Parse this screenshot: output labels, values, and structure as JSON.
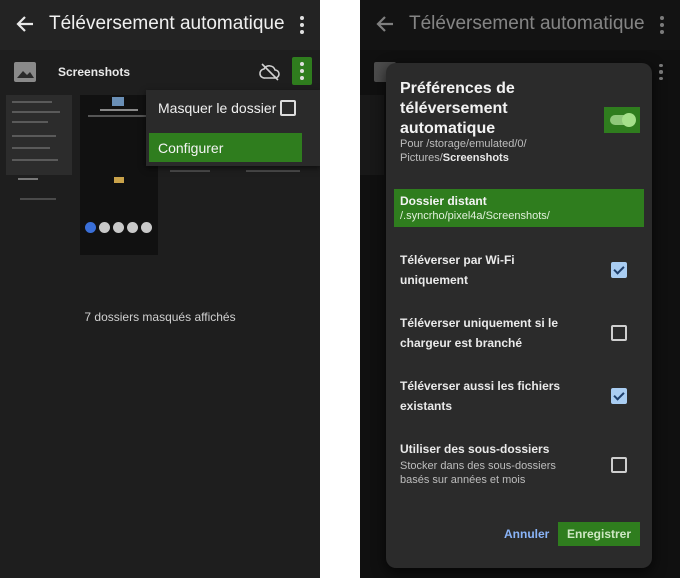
{
  "left_screen": {
    "appbar": {
      "title": "Téléversement automatique",
      "back_icon": "arrow-left-icon",
      "menu_icon": "kebab-icon"
    },
    "folder": {
      "name": "Screenshots",
      "icon": "image-icon",
      "cloud_icon": "cloud-off-icon",
      "menu_icon": "kebab-icon"
    },
    "popup_menu": {
      "hide_folder_label": "Masquer le dossier",
      "hide_folder_checked": false,
      "configure_label": "Configurer"
    },
    "hidden_folders_text": "7 dossiers masqués affichés"
  },
  "right_screen": {
    "appbar": {
      "title": "Téléversement automatique"
    },
    "dialog": {
      "title": "Préférences de téléversement automatique",
      "path_prefix": "Pour /storage/emulated/0/ Pictures/",
      "path_folder": "Screenshots",
      "enabled": true,
      "remote_folder_label": "Dossier distant",
      "remote_folder_value": "/.syncrho/pixel4a/Screenshots/",
      "options": [
        {
          "label": "Téléverser par Wi-Fi uniquement",
          "checked": true
        },
        {
          "label": "Téléverser uniquement si le chargeur est branché",
          "checked": false
        },
        {
          "label": "Téléverser aussi les fichiers existants",
          "checked": true
        },
        {
          "label": "Utiliser des sous-dossiers",
          "sub": "Stocker dans des sous-dossiers basés sur années et mois",
          "checked": false
        }
      ],
      "cancel_label": "Annuler",
      "save_label": "Enregistrer"
    }
  },
  "colors": {
    "accent_green": "#2f7d1e",
    "checkbox_blue": "#a9cdf2",
    "link_blue": "#8ab4f8"
  }
}
